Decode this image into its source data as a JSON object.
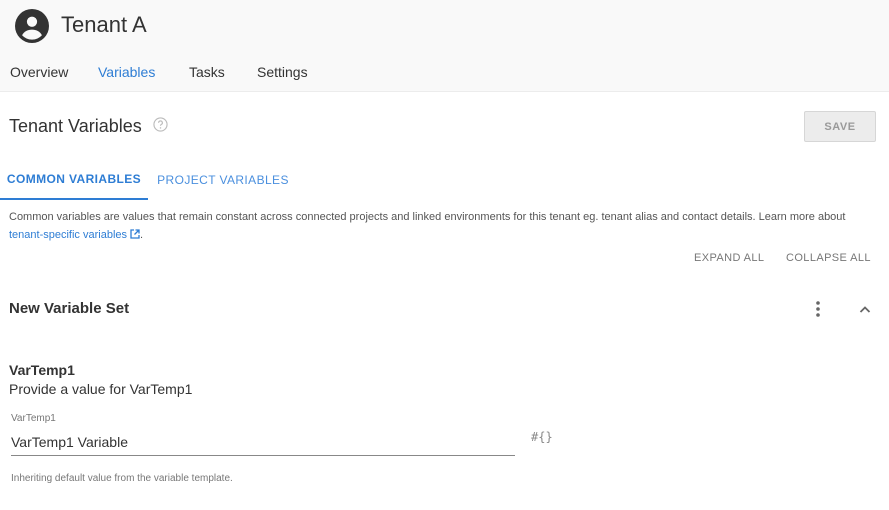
{
  "header": {
    "tenant_name": "Tenant A",
    "avatar_icon": "account-circle-icon"
  },
  "nav": {
    "items": [
      {
        "label": "Overview",
        "active": false
      },
      {
        "label": "Variables",
        "active": true
      },
      {
        "label": "Tasks",
        "active": false
      },
      {
        "label": "Settings",
        "active": false
      }
    ]
  },
  "section": {
    "title": "Tenant Variables",
    "help_icon": "help-circle-icon",
    "save_label": "SAVE"
  },
  "tabs": [
    {
      "label": "COMMON VARIABLES",
      "active": true
    },
    {
      "label": "PROJECT VARIABLES",
      "active": false
    }
  ],
  "description": {
    "text": "Common variables are values that remain constant across connected projects and linked environments for this tenant eg. tenant alias and contact details. Learn more about",
    "link_label": "tenant-specific variables",
    "link_icon": "external-link-icon",
    "trailing": "."
  },
  "controls": {
    "expand_all": "EXPAND ALL",
    "collapse_all": "COLLAPSE ALL"
  },
  "variable_set": {
    "title": "New Variable Set",
    "menu_icon": "more-vertical-icon",
    "collapse_icon": "chevron-up-icon",
    "variables": [
      {
        "name": "VarTemp1",
        "help_text": "Provide a value for VarTemp1",
        "field_label": "VarTemp1",
        "value": "VarTemp1 Variable",
        "hint": "Inheriting default value from the variable template.",
        "insert_icon": "#{}"
      }
    ]
  },
  "colors": {
    "accent": "#2e7dd4",
    "header_bg": "#f9f9f9"
  }
}
